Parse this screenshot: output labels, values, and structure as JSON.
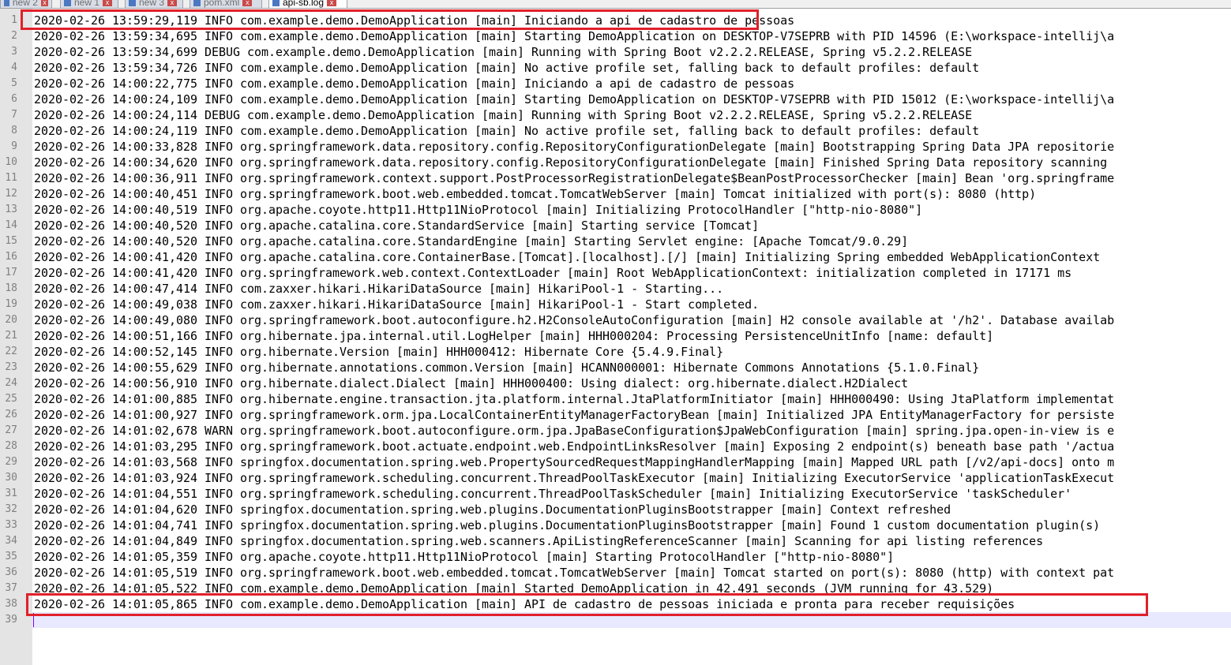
{
  "tabs": [
    {
      "label": "new 2",
      "active": false
    },
    {
      "label": "new 1",
      "active": false
    },
    {
      "label": "new 3",
      "active": false
    },
    {
      "label": "pom.xml",
      "active": false
    },
    {
      "label": "api-sb.log",
      "active": true
    }
  ],
  "editor": {
    "current_line": 39,
    "lines": [
      {
        "n": "1",
        "text": "2020-02-26 13:59:29,119 INFO com.example.demo.DemoApplication [main] Iniciando a api de cadastro de pessoas"
      },
      {
        "n": "2",
        "text": "2020-02-26 13:59:34,695 INFO com.example.demo.DemoApplication [main] Starting DemoApplication on DESKTOP-V7SEPRB with PID 14596 (E:\\workspace-intellij\\a"
      },
      {
        "n": "3",
        "text": "2020-02-26 13:59:34,699 DEBUG com.example.demo.DemoApplication [main] Running with Spring Boot v2.2.2.RELEASE, Spring v5.2.2.RELEASE"
      },
      {
        "n": "4",
        "text": "2020-02-26 13:59:34,726 INFO com.example.demo.DemoApplication [main] No active profile set, falling back to default profiles: default"
      },
      {
        "n": "5",
        "text": "2020-02-26 14:00:22,775 INFO com.example.demo.DemoApplication [main] Iniciando a api de cadastro de pessoas"
      },
      {
        "n": "6",
        "text": "2020-02-26 14:00:24,109 INFO com.example.demo.DemoApplication [main] Starting DemoApplication on DESKTOP-V7SEPRB with PID 15012 (E:\\workspace-intellij\\a"
      },
      {
        "n": "7",
        "text": "2020-02-26 14:00:24,114 DEBUG com.example.demo.DemoApplication [main] Running with Spring Boot v2.2.2.RELEASE, Spring v5.2.2.RELEASE"
      },
      {
        "n": "8",
        "text": "2020-02-26 14:00:24,119 INFO com.example.demo.DemoApplication [main] No active profile set, falling back to default profiles: default"
      },
      {
        "n": "9",
        "text": "2020-02-26 14:00:33,828 INFO org.springframework.data.repository.config.RepositoryConfigurationDelegate [main] Bootstrapping Spring Data JPA repositorie"
      },
      {
        "n": "10",
        "text": "2020-02-26 14:00:34,620 INFO org.springframework.data.repository.config.RepositoryConfigurationDelegate [main] Finished Spring Data repository scanning"
      },
      {
        "n": "11",
        "text": "2020-02-26 14:00:36,911 INFO org.springframework.context.support.PostProcessorRegistrationDelegate$BeanPostProcessorChecker [main] Bean 'org.springframe"
      },
      {
        "n": "12",
        "text": "2020-02-26 14:00:40,451 INFO org.springframework.boot.web.embedded.tomcat.TomcatWebServer [main] Tomcat initialized with port(s): 8080 (http)"
      },
      {
        "n": "13",
        "text": "2020-02-26 14:00:40,519 INFO org.apache.coyote.http11.Http11NioProtocol [main] Initializing ProtocolHandler [\"http-nio-8080\"]"
      },
      {
        "n": "14",
        "text": "2020-02-26 14:00:40,520 INFO org.apache.catalina.core.StandardService [main] Starting service [Tomcat]"
      },
      {
        "n": "15",
        "text": "2020-02-26 14:00:40,520 INFO org.apache.catalina.core.StandardEngine [main] Starting Servlet engine: [Apache Tomcat/9.0.29]"
      },
      {
        "n": "16",
        "text": "2020-02-26 14:00:41,420 INFO org.apache.catalina.core.ContainerBase.[Tomcat].[localhost].[/] [main] Initializing Spring embedded WebApplicationContext"
      },
      {
        "n": "17",
        "text": "2020-02-26 14:00:41,420 INFO org.springframework.web.context.ContextLoader [main] Root WebApplicationContext: initialization completed in 17171 ms"
      },
      {
        "n": "18",
        "text": "2020-02-26 14:00:47,414 INFO com.zaxxer.hikari.HikariDataSource [main] HikariPool-1 - Starting..."
      },
      {
        "n": "19",
        "text": "2020-02-26 14:00:49,038 INFO com.zaxxer.hikari.HikariDataSource [main] HikariPool-1 - Start completed."
      },
      {
        "n": "20",
        "text": "2020-02-26 14:00:49,080 INFO org.springframework.boot.autoconfigure.h2.H2ConsoleAutoConfiguration [main] H2 console available at '/h2'. Database availab"
      },
      {
        "n": "21",
        "text": "2020-02-26 14:00:51,166 INFO org.hibernate.jpa.internal.util.LogHelper [main] HHH000204: Processing PersistenceUnitInfo [name: default]"
      },
      {
        "n": "22",
        "text": "2020-02-26 14:00:52,145 INFO org.hibernate.Version [main] HHH000412: Hibernate Core {5.4.9.Final}"
      },
      {
        "n": "23",
        "text": "2020-02-26 14:00:55,629 INFO org.hibernate.annotations.common.Version [main] HCANN000001: Hibernate Commons Annotations {5.1.0.Final}"
      },
      {
        "n": "24",
        "text": "2020-02-26 14:00:56,910 INFO org.hibernate.dialect.Dialect [main] HHH000400: Using dialect: org.hibernate.dialect.H2Dialect"
      },
      {
        "n": "25",
        "text": "2020-02-26 14:01:00,885 INFO org.hibernate.engine.transaction.jta.platform.internal.JtaPlatformInitiator [main] HHH000490: Using JtaPlatform implementat"
      },
      {
        "n": "26",
        "text": "2020-02-26 14:01:00,927 INFO org.springframework.orm.jpa.LocalContainerEntityManagerFactoryBean [main] Initialized JPA EntityManagerFactory for persiste"
      },
      {
        "n": "27",
        "text": "2020-02-26 14:01:02,678 WARN org.springframework.boot.autoconfigure.orm.jpa.JpaBaseConfiguration$JpaWebConfiguration [main] spring.jpa.open-in-view is e"
      },
      {
        "n": "28",
        "text": "2020-02-26 14:01:03,295 INFO org.springframework.boot.actuate.endpoint.web.EndpointLinksResolver [main] Exposing 2 endpoint(s) beneath base path '/actua"
      },
      {
        "n": "29",
        "text": "2020-02-26 14:01:03,568 INFO springfox.documentation.spring.web.PropertySourcedRequestMappingHandlerMapping [main] Mapped URL path [/v2/api-docs] onto m"
      },
      {
        "n": "30",
        "text": "2020-02-26 14:01:03,924 INFO org.springframework.scheduling.concurrent.ThreadPoolTaskExecutor [main] Initializing ExecutorService 'applicationTaskExecut"
      },
      {
        "n": "31",
        "text": "2020-02-26 14:01:04,551 INFO org.springframework.scheduling.concurrent.ThreadPoolTaskScheduler [main] Initializing ExecutorService 'taskScheduler'"
      },
      {
        "n": "32",
        "text": "2020-02-26 14:01:04,620 INFO springfox.documentation.spring.web.plugins.DocumentationPluginsBootstrapper [main] Context refreshed"
      },
      {
        "n": "33",
        "text": "2020-02-26 14:01:04,741 INFO springfox.documentation.spring.web.plugins.DocumentationPluginsBootstrapper [main] Found 1 custom documentation plugin(s)"
      },
      {
        "n": "34",
        "text": "2020-02-26 14:01:04,849 INFO springfox.documentation.spring.web.scanners.ApiListingReferenceScanner [main] Scanning for api listing references"
      },
      {
        "n": "35",
        "text": "2020-02-26 14:01:05,359 INFO org.apache.coyote.http11.Http11NioProtocol [main] Starting ProtocolHandler [\"http-nio-8080\"]"
      },
      {
        "n": "36",
        "text": "2020-02-26 14:01:05,519 INFO org.springframework.boot.web.embedded.tomcat.TomcatWebServer [main] Tomcat started on port(s): 8080 (http) with context pat"
      },
      {
        "n": "37",
        "text": "2020-02-26 14:01:05,522 INFO com.example.demo.DemoApplication [main] Started DemoApplication in 42.491 seconds (JVM running for 43.529)"
      },
      {
        "n": "38",
        "text": "2020-02-26 14:01:05,865 INFO com.example.demo.DemoApplication [main] API de cadastro de pessoas iniciada e pronta para receber requisições"
      },
      {
        "n": "39",
        "text": ""
      }
    ]
  },
  "annotations": {
    "highlight_color": "#e0202a",
    "highlighted_lines": [
      1,
      38
    ]
  }
}
